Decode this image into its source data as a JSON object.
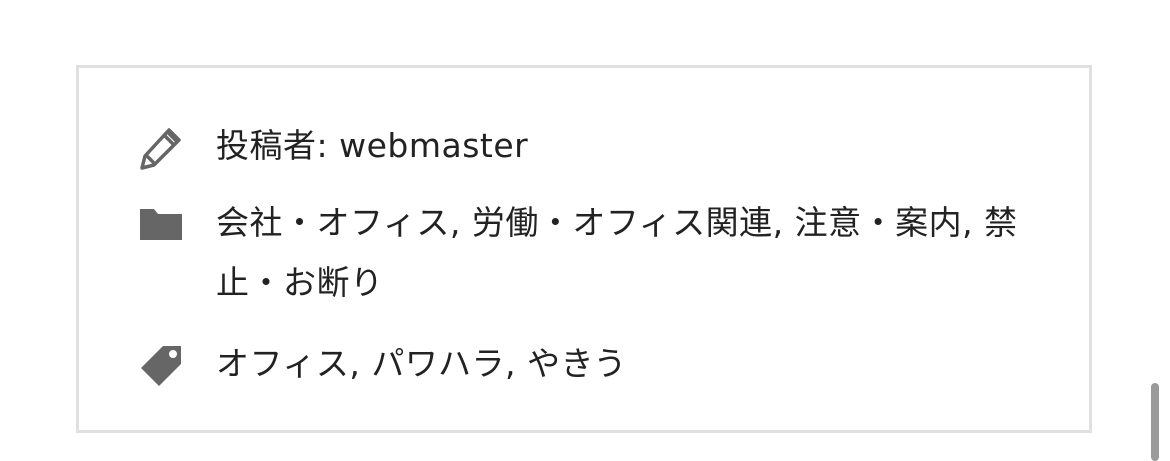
{
  "post_meta": {
    "author": {
      "icon": "pencil-icon",
      "prefix": "投稿者: ",
      "name": "webmaster"
    },
    "categories": {
      "icon": "folder-icon",
      "items": [
        "会社・オフィス",
        "労働・オフィス関連",
        "注意・案内",
        "禁止・お断り"
      ],
      "separator": ", "
    },
    "tags": {
      "icon": "tag-icon",
      "items": [
        "オフィス",
        "パワハラ",
        "やきう"
      ],
      "separator": ", "
    }
  },
  "colors": {
    "icon": "#666666",
    "border": "#e0e0e0",
    "text": "#222222",
    "scrollbar": "#9a9a9a"
  }
}
